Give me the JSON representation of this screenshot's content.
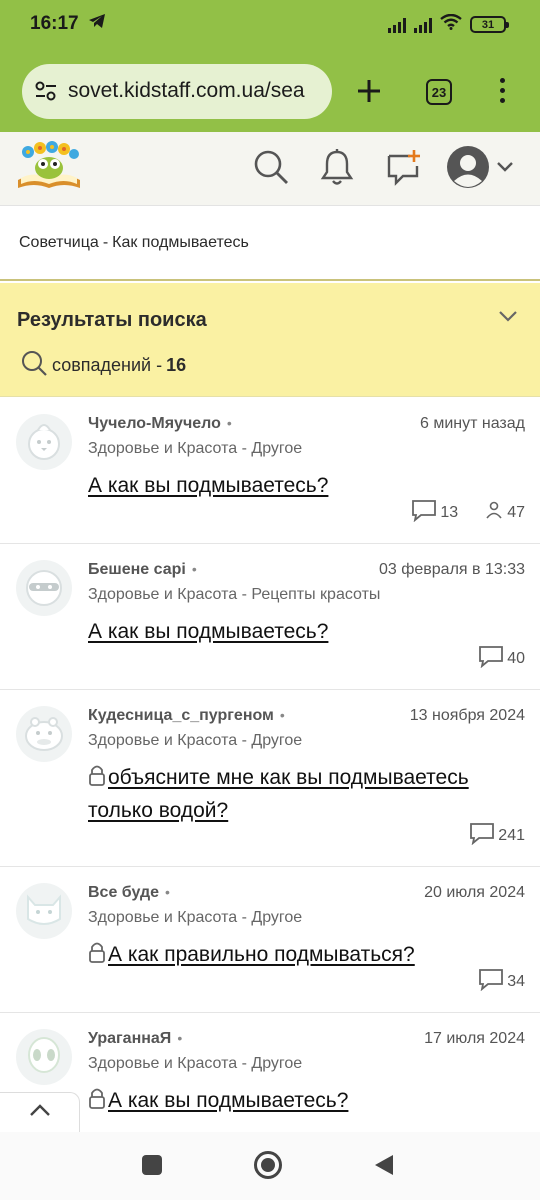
{
  "status_bar": {
    "time": "16:17",
    "battery": "31"
  },
  "browser": {
    "url": "sovet.kidstaff.com.ua/sea",
    "tab_count": "23"
  },
  "breadcrumb": {
    "section": "Советчица",
    "separator": "-",
    "query": "Как подмываетесь"
  },
  "results": {
    "title": "Результаты поиска",
    "count_label": "совпадений -",
    "count": "16"
  },
  "posts": [
    {
      "author": "Чучело-Мяучело",
      "date": "6 минут назад",
      "category": "Здоровье и Красота - Другое",
      "title": "А как вы подмываетесь?",
      "comments": "13",
      "views": "47",
      "locked": false,
      "avatar": "chick"
    },
    {
      "author": "Бешене сарі",
      "date": "03 февраля в 13:33",
      "category": "Здоровье и Красота - Рецепты красоты",
      "title": "А как вы подмываетесь?",
      "comments": "40",
      "locked": false,
      "avatar": "ninja"
    },
    {
      "author": "Кудесница_с_пургеном",
      "date": "13 ноября 2024",
      "category": "Здоровье и Красота - Другое",
      "title": "объясните мне как вы подмываетесь только водой?",
      "comments": "241",
      "locked": true,
      "avatar": "hippo"
    },
    {
      "author": "Все буде",
      "date": "20 июля 2024",
      "category": "Здоровье и Красота - Другое",
      "title": "А как правильно подмываться?",
      "comments": "34",
      "locked": true,
      "avatar": "cat"
    },
    {
      "author": "УраганнаЯ",
      "date": "17 июля 2024",
      "category": "Здоровье и Красота - Другое",
      "title": "А как вы подмываетесь?",
      "comments": "",
      "locked": true,
      "avatar": "alien"
    }
  ],
  "colors": {
    "browser_bar": "#92c047",
    "results_panel": "#faf1a3"
  }
}
